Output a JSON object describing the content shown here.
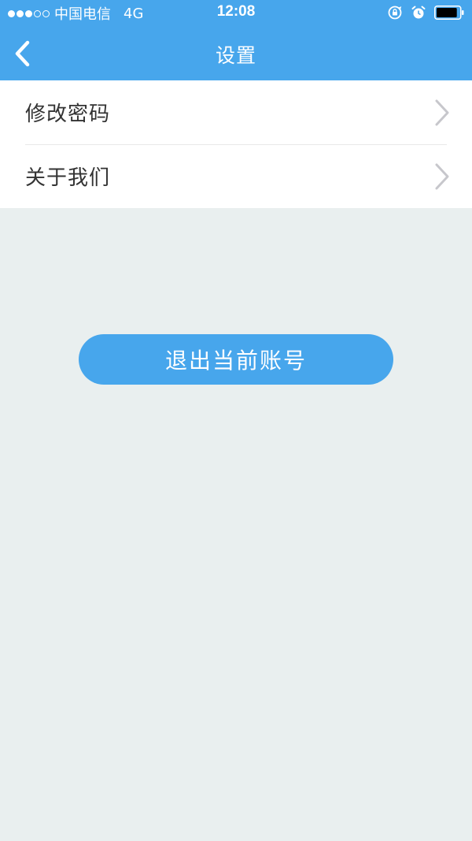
{
  "status_bar": {
    "carrier": "中国电信",
    "network": "4G",
    "time": "12:08",
    "signal_bars_filled": 3,
    "signal_bars_total": 5,
    "battery_level": 0.9
  },
  "nav": {
    "title": "设置",
    "back_icon": "chevron-left-icon"
  },
  "menu": {
    "items": [
      {
        "label": "修改密码",
        "icon": "chevron-right-icon"
      },
      {
        "label": "关于我们",
        "icon": "chevron-right-icon"
      }
    ]
  },
  "logout": {
    "label": "退出当前账号"
  },
  "colors": {
    "primary": "#47a6ec",
    "background": "#e9efef",
    "text": "#333333",
    "chevron": "#c7c7cc"
  }
}
